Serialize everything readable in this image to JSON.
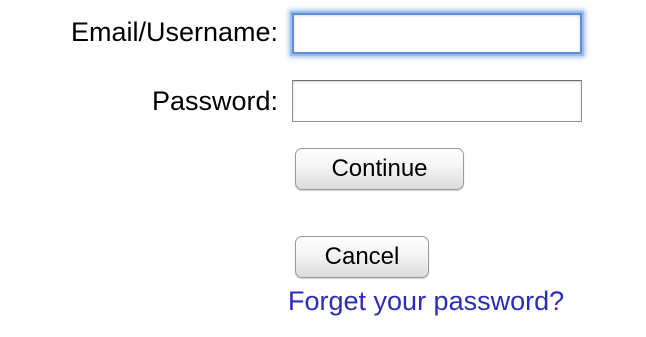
{
  "form": {
    "email_label": "Email/Username:",
    "email_value": "",
    "password_label": "Password:",
    "password_value": "",
    "continue_label": "Continue",
    "cancel_label": "Cancel",
    "forgot_link": "Forget your password?"
  },
  "colors": {
    "link": "#2b2bbd",
    "focus_ring": "#5f8fd6"
  }
}
